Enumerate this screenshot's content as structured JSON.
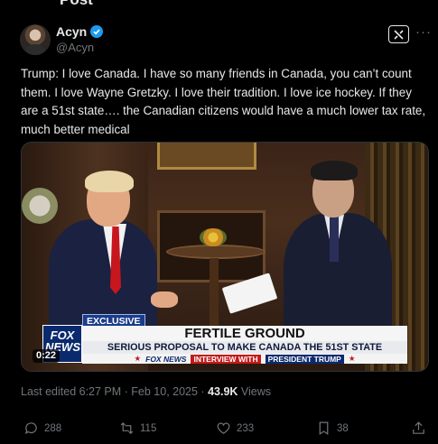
{
  "header": {
    "title": "Post"
  },
  "author": {
    "name": "Acyn",
    "handle": "@Acyn",
    "verified": true
  },
  "tweet": {
    "text": "Trump: I love Canada. I have so many friends in Canada, you can’t count them. I love Wayne Gretzky. I love their tradition. I love ice hockey.  If they are a 51st state…. the Canadian citizens would have a much lower tax rate, much better medical"
  },
  "video": {
    "duration": "0:22",
    "chyron": {
      "tag": "EXCLUSIVE",
      "logo_text": "FOX NEWS",
      "headline": "FERTILE GROUND",
      "subheadline": "SERIOUS PROPOSAL TO MAKE CANADA THE 51ST STATE",
      "ticker_network": "FOX NEWS",
      "ticker_label": "INTERVIEW WITH",
      "ticker_subject": "PRESIDENT TRUMP"
    }
  },
  "meta": {
    "edited": "Last edited 6:27 PM · Feb 10, 2025 · ",
    "views_count": "43.9K",
    "views_label": " Views"
  },
  "actions": {
    "replies": "288",
    "reposts": "115",
    "likes": "233",
    "bookmarks": "38"
  },
  "colors": {
    "background": "#000000",
    "text": "#e7e9ea",
    "muted": "#71767b",
    "verified": "#1d9bf0"
  },
  "icons": [
    "grok-icon",
    "more-icon",
    "reply-icon",
    "repost-icon",
    "like-icon",
    "bookmark-icon",
    "share-icon",
    "verified-badge-icon"
  ]
}
